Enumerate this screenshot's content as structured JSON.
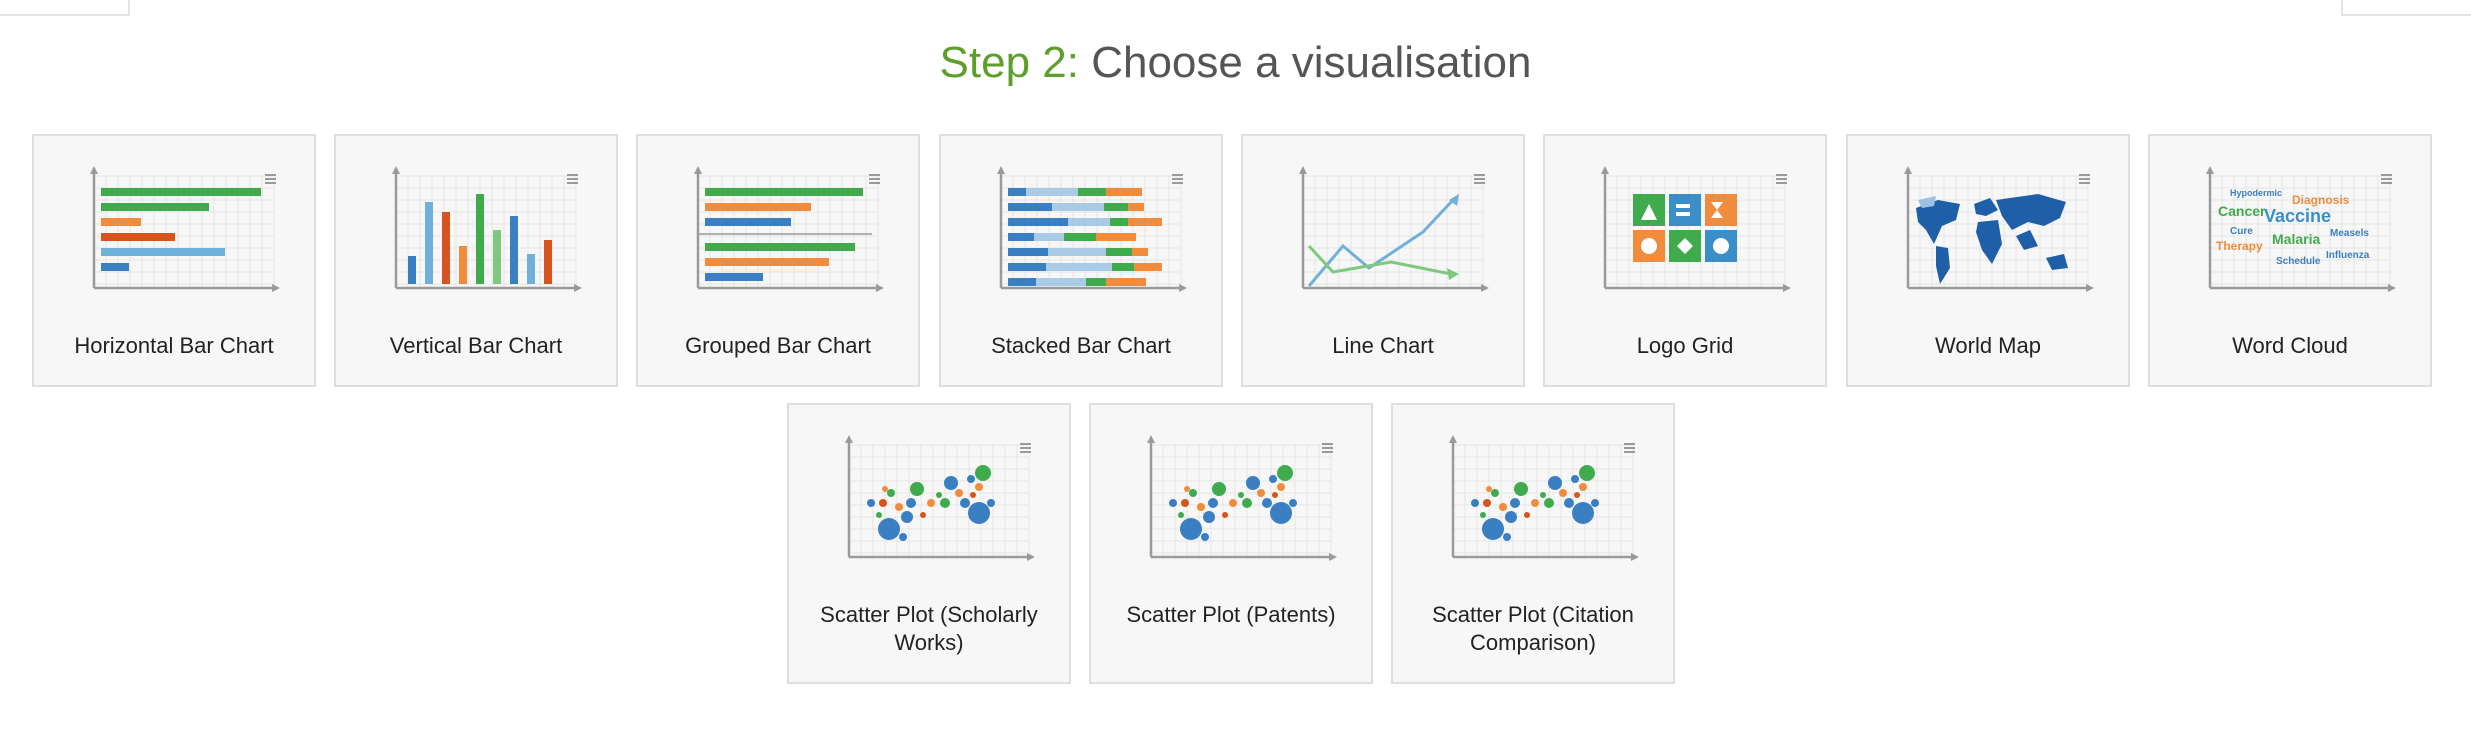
{
  "heading": {
    "step": "Step 2:",
    "title": "Choose a visualisation"
  },
  "colors": {
    "green": "#3fab4d",
    "orange": "#f08c3c",
    "red": "#d6541d",
    "blue": "#3a7fc1",
    "lightblue": "#6fb1d8",
    "palegreen": "#7fc97f"
  },
  "cards": [
    {
      "label": "Horizontal Bar Chart",
      "icon": "horizontal-bar-chart-icon"
    },
    {
      "label": "Vertical Bar Chart",
      "icon": "vertical-bar-chart-icon"
    },
    {
      "label": "Grouped Bar Chart",
      "icon": "grouped-bar-chart-icon"
    },
    {
      "label": "Stacked Bar Chart",
      "icon": "stacked-bar-chart-icon"
    },
    {
      "label": "Line Chart",
      "icon": "line-chart-icon"
    },
    {
      "label": "Logo Grid",
      "icon": "logo-grid-icon"
    },
    {
      "label": "World Map",
      "icon": "world-map-icon"
    },
    {
      "label": "Word Cloud",
      "icon": "word-cloud-icon",
      "words": [
        "Hypodermic",
        "Diagnosis",
        "Cancer",
        "Vaccine",
        "Cure",
        "Measels",
        "Malaria",
        "Therapy",
        "Influenza",
        "Schedule"
      ]
    },
    {
      "label": "Scatter Plot (Scholarly Works)",
      "icon": "scatter-plot-icon"
    },
    {
      "label": "Scatter Plot (Patents)",
      "icon": "scatter-plot-icon"
    },
    {
      "label": "Scatter Plot (Citation Comparison)",
      "icon": "scatter-plot-icon"
    }
  ]
}
